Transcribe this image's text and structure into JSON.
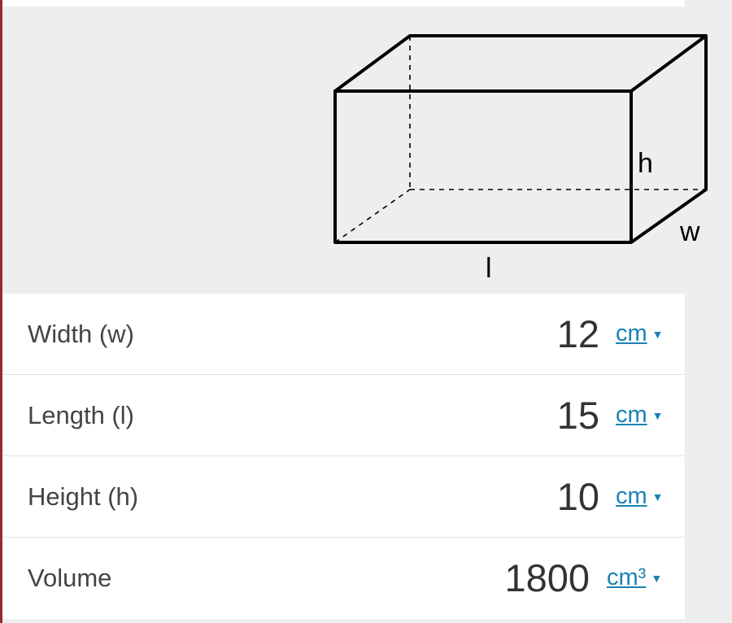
{
  "diagram": {
    "label_h": "h",
    "label_w": "w",
    "label_l": "l"
  },
  "fields": [
    {
      "label": "Width (w)",
      "value": "12",
      "unit": "cm"
    },
    {
      "label": "Length (l)",
      "value": "15",
      "unit": "cm"
    },
    {
      "label": "Height (h)",
      "value": "10",
      "unit": "cm"
    },
    {
      "label": "Volume",
      "value": "1800",
      "unit": "cm³"
    }
  ],
  "dropdown_caret": "▼",
  "colors": {
    "accent_link": "#1a82b4",
    "left_accent": "#9b2a2a",
    "panel_bg": "#eeeeee"
  }
}
